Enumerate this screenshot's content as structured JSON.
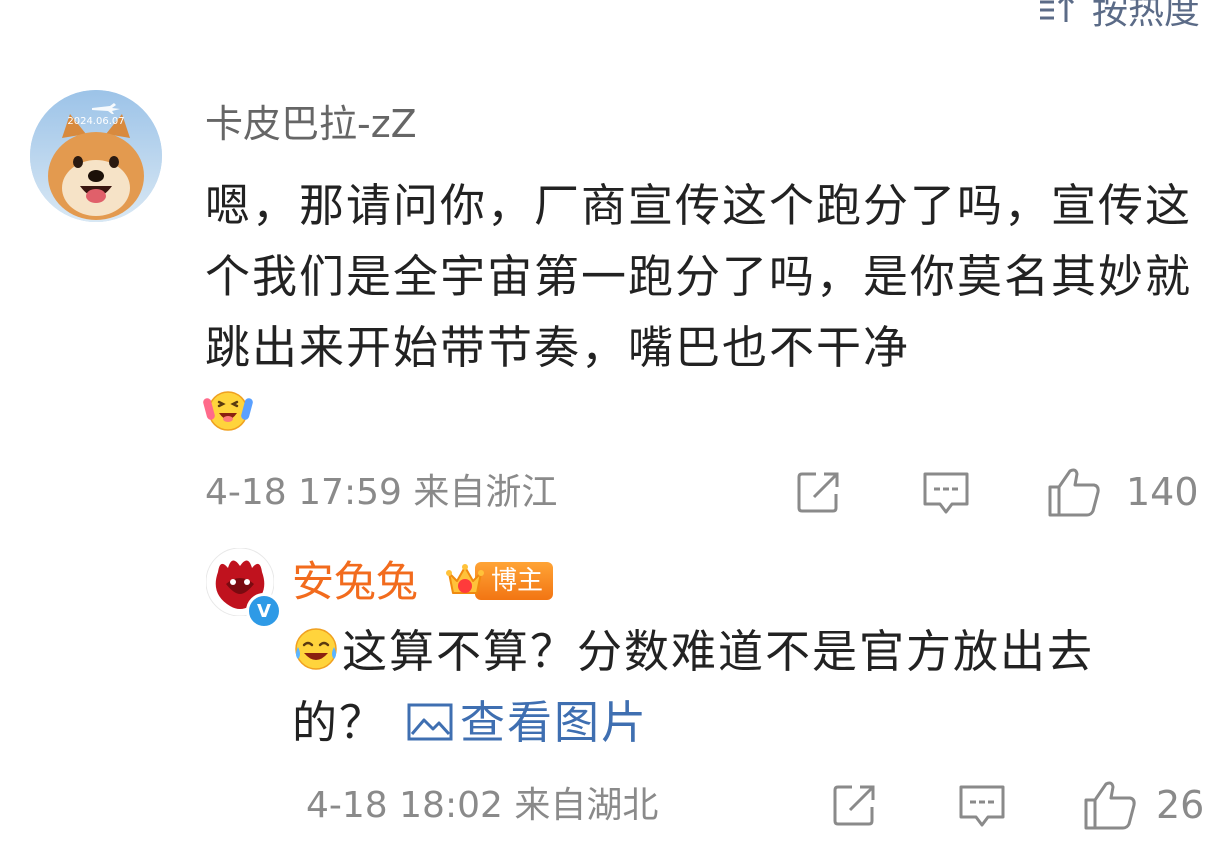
{
  "sort": {
    "label": "按热度"
  },
  "comments": [
    {
      "avatar_stamp": "2024.06.07",
      "username": "卡皮巴拉-zZ",
      "text": "嗯，那请问你，厂商宣传这个跑分了吗，宣传这个我们是全宇宙第一跑分了吗，是你莫名其妙就跳出来开始带节奏，嘴巴也不干净",
      "emoji": "excited-face-emoji",
      "timestamp": "4-18 17:59",
      "location": "来自浙江",
      "likes": "140"
    }
  ],
  "reply": {
    "username": "安兔兔",
    "badge": "博主",
    "verified": true,
    "emoji": "crying-laughing-emoji",
    "text": "这算不算？分数难道不是官方放出去的？",
    "view_pic_label": "查看图片",
    "timestamp": "4-18 18:02",
    "location": "来自湖北",
    "likes": "26"
  },
  "colors": {
    "link": "#3f6fb1",
    "author_name": "#f26b1d",
    "meta": "#8a8a8a",
    "verify": "#2e9ae6"
  }
}
